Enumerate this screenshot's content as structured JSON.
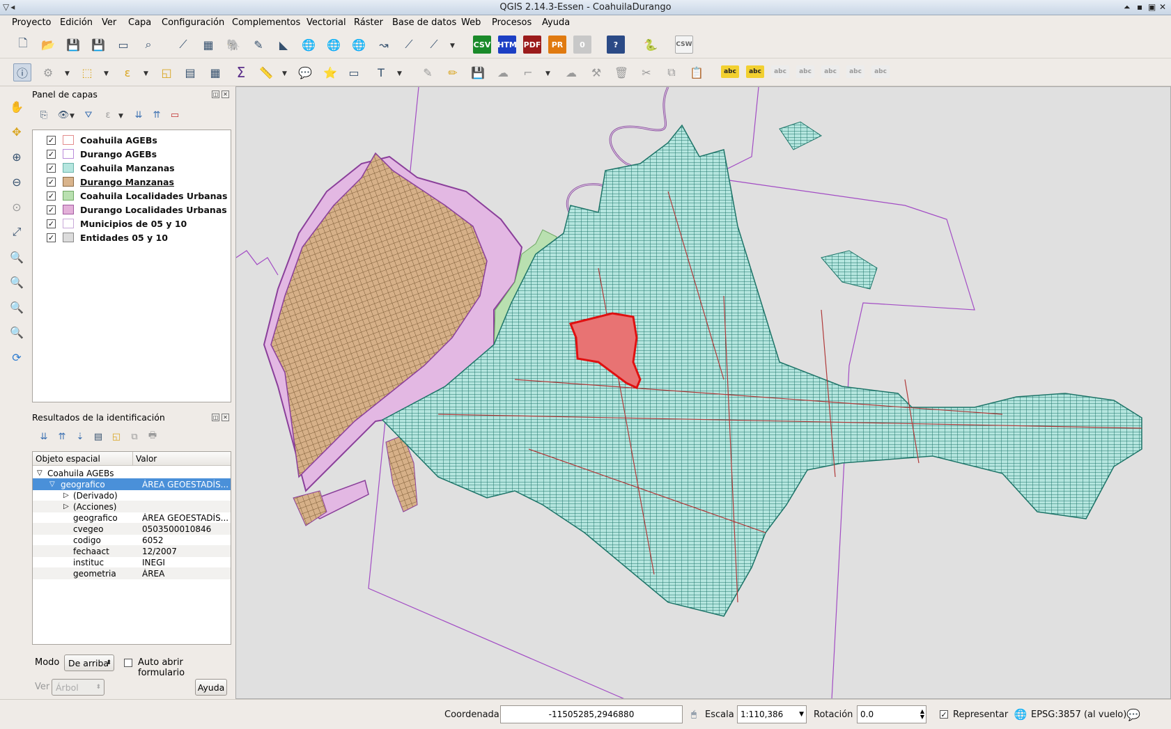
{
  "window": {
    "title": "QGIS 2.14.3-Essen - CoahuilaDurango"
  },
  "menu": [
    "Proyecto",
    "Edición",
    "Ver",
    "Capa",
    "Configuración",
    "Complementos",
    "Vectorial",
    "Ráster",
    "Base de datos",
    "Web",
    "Procesos",
    "Ayuda"
  ],
  "toolbar_labels": {
    "csv": "CSV",
    "htm": "HTM",
    "pdf": "PDF",
    "pr": "PR",
    "zero": "0",
    "csw": "CSW",
    "abc": "abc"
  },
  "layers_panel": {
    "title": "Panel de capas",
    "layers": [
      {
        "name": "Coahuila AGEBs",
        "color": "#ffffff",
        "border": "#e38d8d"
      },
      {
        "name": "Durango AGEBs",
        "color": "#ffffff",
        "border": "#b98ad9"
      },
      {
        "name": "Coahuila Manzanas",
        "color": "#b5e6df",
        "border": "#6ab3aa"
      },
      {
        "name": "Durango Manzanas",
        "color": "#d9b48c",
        "border": "#8c6b45"
      },
      {
        "name": "Coahuila Localidades Urbanas",
        "color": "#b9e0b0",
        "border": "#6fa864"
      },
      {
        "name": "Durango Localidades Urbanas",
        "color": "#e3b0d9",
        "border": "#a25aa0"
      },
      {
        "name": "Municipios de 05 y 10",
        "color": "#ffffff",
        "border": "#c8a8d8"
      },
      {
        "name": "Entidades 05 y 10",
        "color": "#dcdcdc",
        "border": "#888888"
      }
    ]
  },
  "identify_panel": {
    "title": "Resultados de la identificación",
    "col_feature": "Objeto espacial",
    "col_value": "Valor",
    "root": "Coahuila AGEBs",
    "selected": {
      "key": "geografico",
      "value": "ÁREA GEOESTADÍS..."
    },
    "derived": "(Derivado)",
    "actions": "(Acciones)",
    "attributes": [
      {
        "key": "geografico",
        "value": "ÁREA GEOESTADÍS..."
      },
      {
        "key": "cvegeo",
        "value": "0503500010846"
      },
      {
        "key": "codigo",
        "value": "6052"
      },
      {
        "key": "fechaact",
        "value": "12/2007"
      },
      {
        "key": "instituc",
        "value": "INEGI"
      },
      {
        "key": "geometria",
        "value": "ÁREA"
      }
    ],
    "mode_label": "Modo",
    "mode_value": "De arriba",
    "auto_open": "Auto abrir formulario",
    "view_label": "Ver",
    "view_value": "Árbol",
    "help_button": "Ayuda"
  },
  "status": {
    "coord_label": "Coordenada",
    "coord_value": "-11505285,2946880",
    "scale_label": "Escala",
    "scale_value": "1:110,386",
    "rotation_label": "Rotación",
    "rotation_value": "0.0",
    "render_label": "Representar",
    "crs": "EPSG:3857 (al vuelo)"
  },
  "colors": {
    "coahuila_fill": "#b5e6df",
    "coahuila_line": "#1d7468",
    "durango_fill": "#d9b48c",
    "durango_line": "#7a5a35",
    "durango_loc": "#e3b8e3",
    "ageb_line": "#b03a3a",
    "selection": "#e87373",
    "municipio_line": "#a24cc4",
    "river": "#8a4f9e"
  }
}
